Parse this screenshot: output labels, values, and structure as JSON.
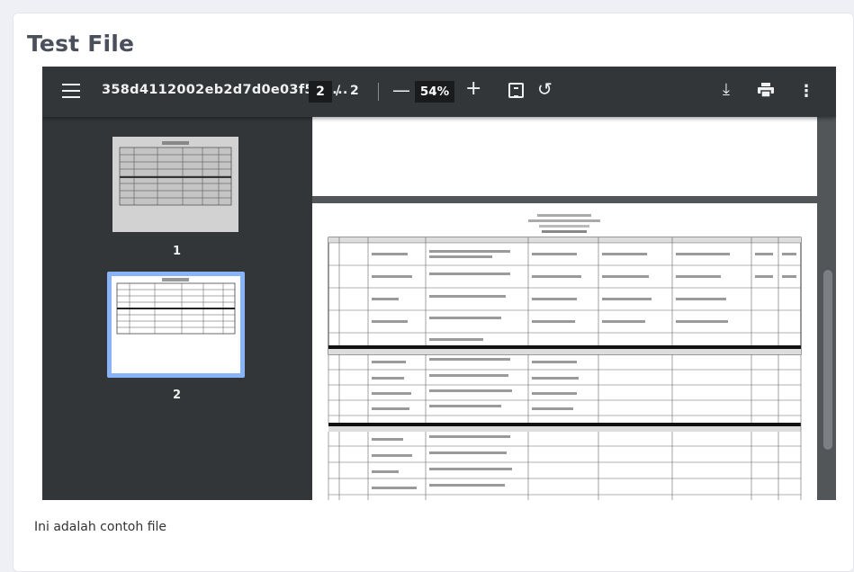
{
  "page": {
    "title": "Test File"
  },
  "viewer": {
    "document_name": "358d4112002eb2d7d0e03f5a8...",
    "current_page": "2",
    "page_separator": "/",
    "total_pages": "2",
    "zoom": "54%",
    "zoom_out_glyph": "—",
    "zoom_in_glyph": "+",
    "rotate_glyph": "↺",
    "download_glyph": "⤓",
    "more_glyph": "⋮",
    "thumbnails": [
      {
        "label": "1"
      },
      {
        "label": "2"
      }
    ]
  },
  "description": "Ini adalah contoh file",
  "colors": {
    "toolbar": "#323639",
    "viewer_bg": "#525659",
    "selected_thumb": "#8ab4f8"
  }
}
